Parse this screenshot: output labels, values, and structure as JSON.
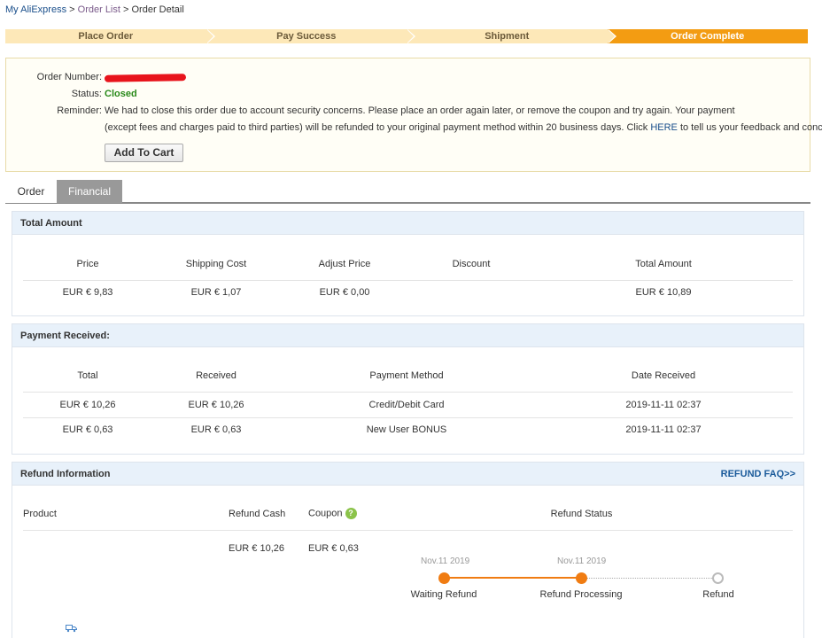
{
  "breadcrumb": {
    "home": "My AliExpress",
    "sep1": ">",
    "order_list": "Order List",
    "sep2": ">",
    "current": "Order Detail"
  },
  "steps": [
    {
      "label": "Place Order",
      "active": false
    },
    {
      "label": "Pay Success",
      "active": false
    },
    {
      "label": "Shipment",
      "active": false
    },
    {
      "label": "Order Complete",
      "active": true
    }
  ],
  "order_info": {
    "order_number_label": "Order Number:",
    "status_label": "Status:",
    "status_value": "Closed",
    "reminder_label": "Reminder:",
    "reminder_line1": "We had to close this order due to account security concerns. Please place an order again later, or remove the coupon and try again. Your payment",
    "reminder_line2_a": "(except fees and charges paid to third parties) will be refunded to your original payment method within 20 business days. Click ",
    "reminder_here": "HERE",
    "reminder_line2_b": " to tell us your feedback and concerns.",
    "add_to_cart": "Add To Cart"
  },
  "tabs": {
    "order": "Order",
    "financial": "Financial"
  },
  "total_amount": {
    "title": "Total Amount",
    "headers": [
      "Price",
      "Shipping Cost",
      "Adjust Price",
      "Discount",
      "Total Amount"
    ],
    "values": [
      "EUR € 9,83",
      "EUR € 1,07",
      "EUR € 0,00",
      "",
      "EUR € 10,89"
    ]
  },
  "payment_received": {
    "title": "Payment Received:",
    "headers": [
      "Total",
      "Received",
      "Payment Method",
      "Date Received"
    ],
    "rows": [
      [
        "EUR € 10,26",
        "EUR € 10,26",
        "Credit/Debit Card",
        "2019-11-11 02:37"
      ],
      [
        "EUR € 0,63",
        "EUR € 0,63",
        "New User BONUS",
        "2019-11-11 02:37"
      ]
    ]
  },
  "refund": {
    "title": "Refund Information",
    "faq": "REFUND FAQ>>",
    "headers": {
      "product": "Product",
      "refund_cash": "Refund Cash",
      "coupon": "Coupon",
      "coupon_help": "?",
      "refund_status": "Refund Status"
    },
    "refund_cash_value": "EUR € 10,26",
    "coupon_value": "EUR € 0,63",
    "timeline": [
      {
        "date": "Nov.11 2019",
        "label": "Waiting Refund",
        "done": true
      },
      {
        "date": "Nov.11 2019",
        "label": "Refund Processing",
        "done": true
      },
      {
        "date": "",
        "label": "Refund",
        "done": false
      }
    ],
    "icon": "truck-icon"
  },
  "colors": {
    "accent_orange": "#f39c12",
    "step_bg": "#fde8b8",
    "status_green": "#2a8a1a",
    "link_blue": "#1a4f8b",
    "panel_header_bg": "#e8f1fa"
  }
}
